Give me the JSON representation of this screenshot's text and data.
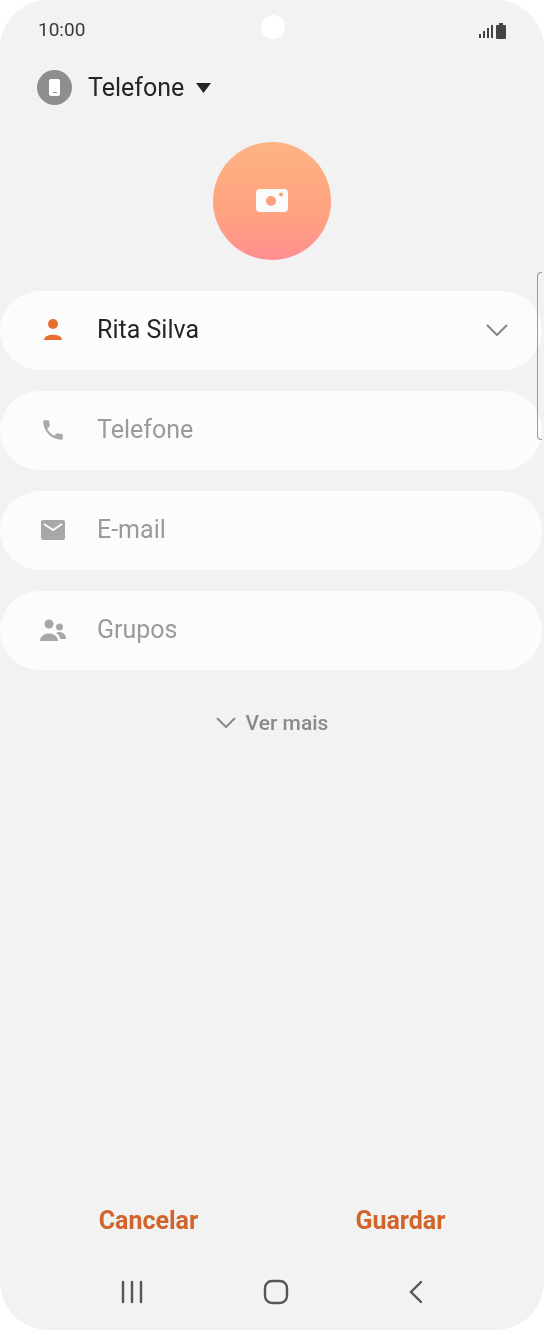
{
  "status_bar": {
    "time": "10:00"
  },
  "account": {
    "label": "Telefone"
  },
  "fields": [
    {
      "kind": "name",
      "value": "Rita Silva"
    },
    {
      "kind": "phone",
      "placeholder": "Telefone"
    },
    {
      "kind": "email",
      "placeholder": "E-mail"
    },
    {
      "kind": "groups",
      "placeholder": "Grupos"
    }
  ],
  "more_link": "Ver mais",
  "buttons": {
    "cancel": "Cancelar",
    "save": "Guardar"
  }
}
